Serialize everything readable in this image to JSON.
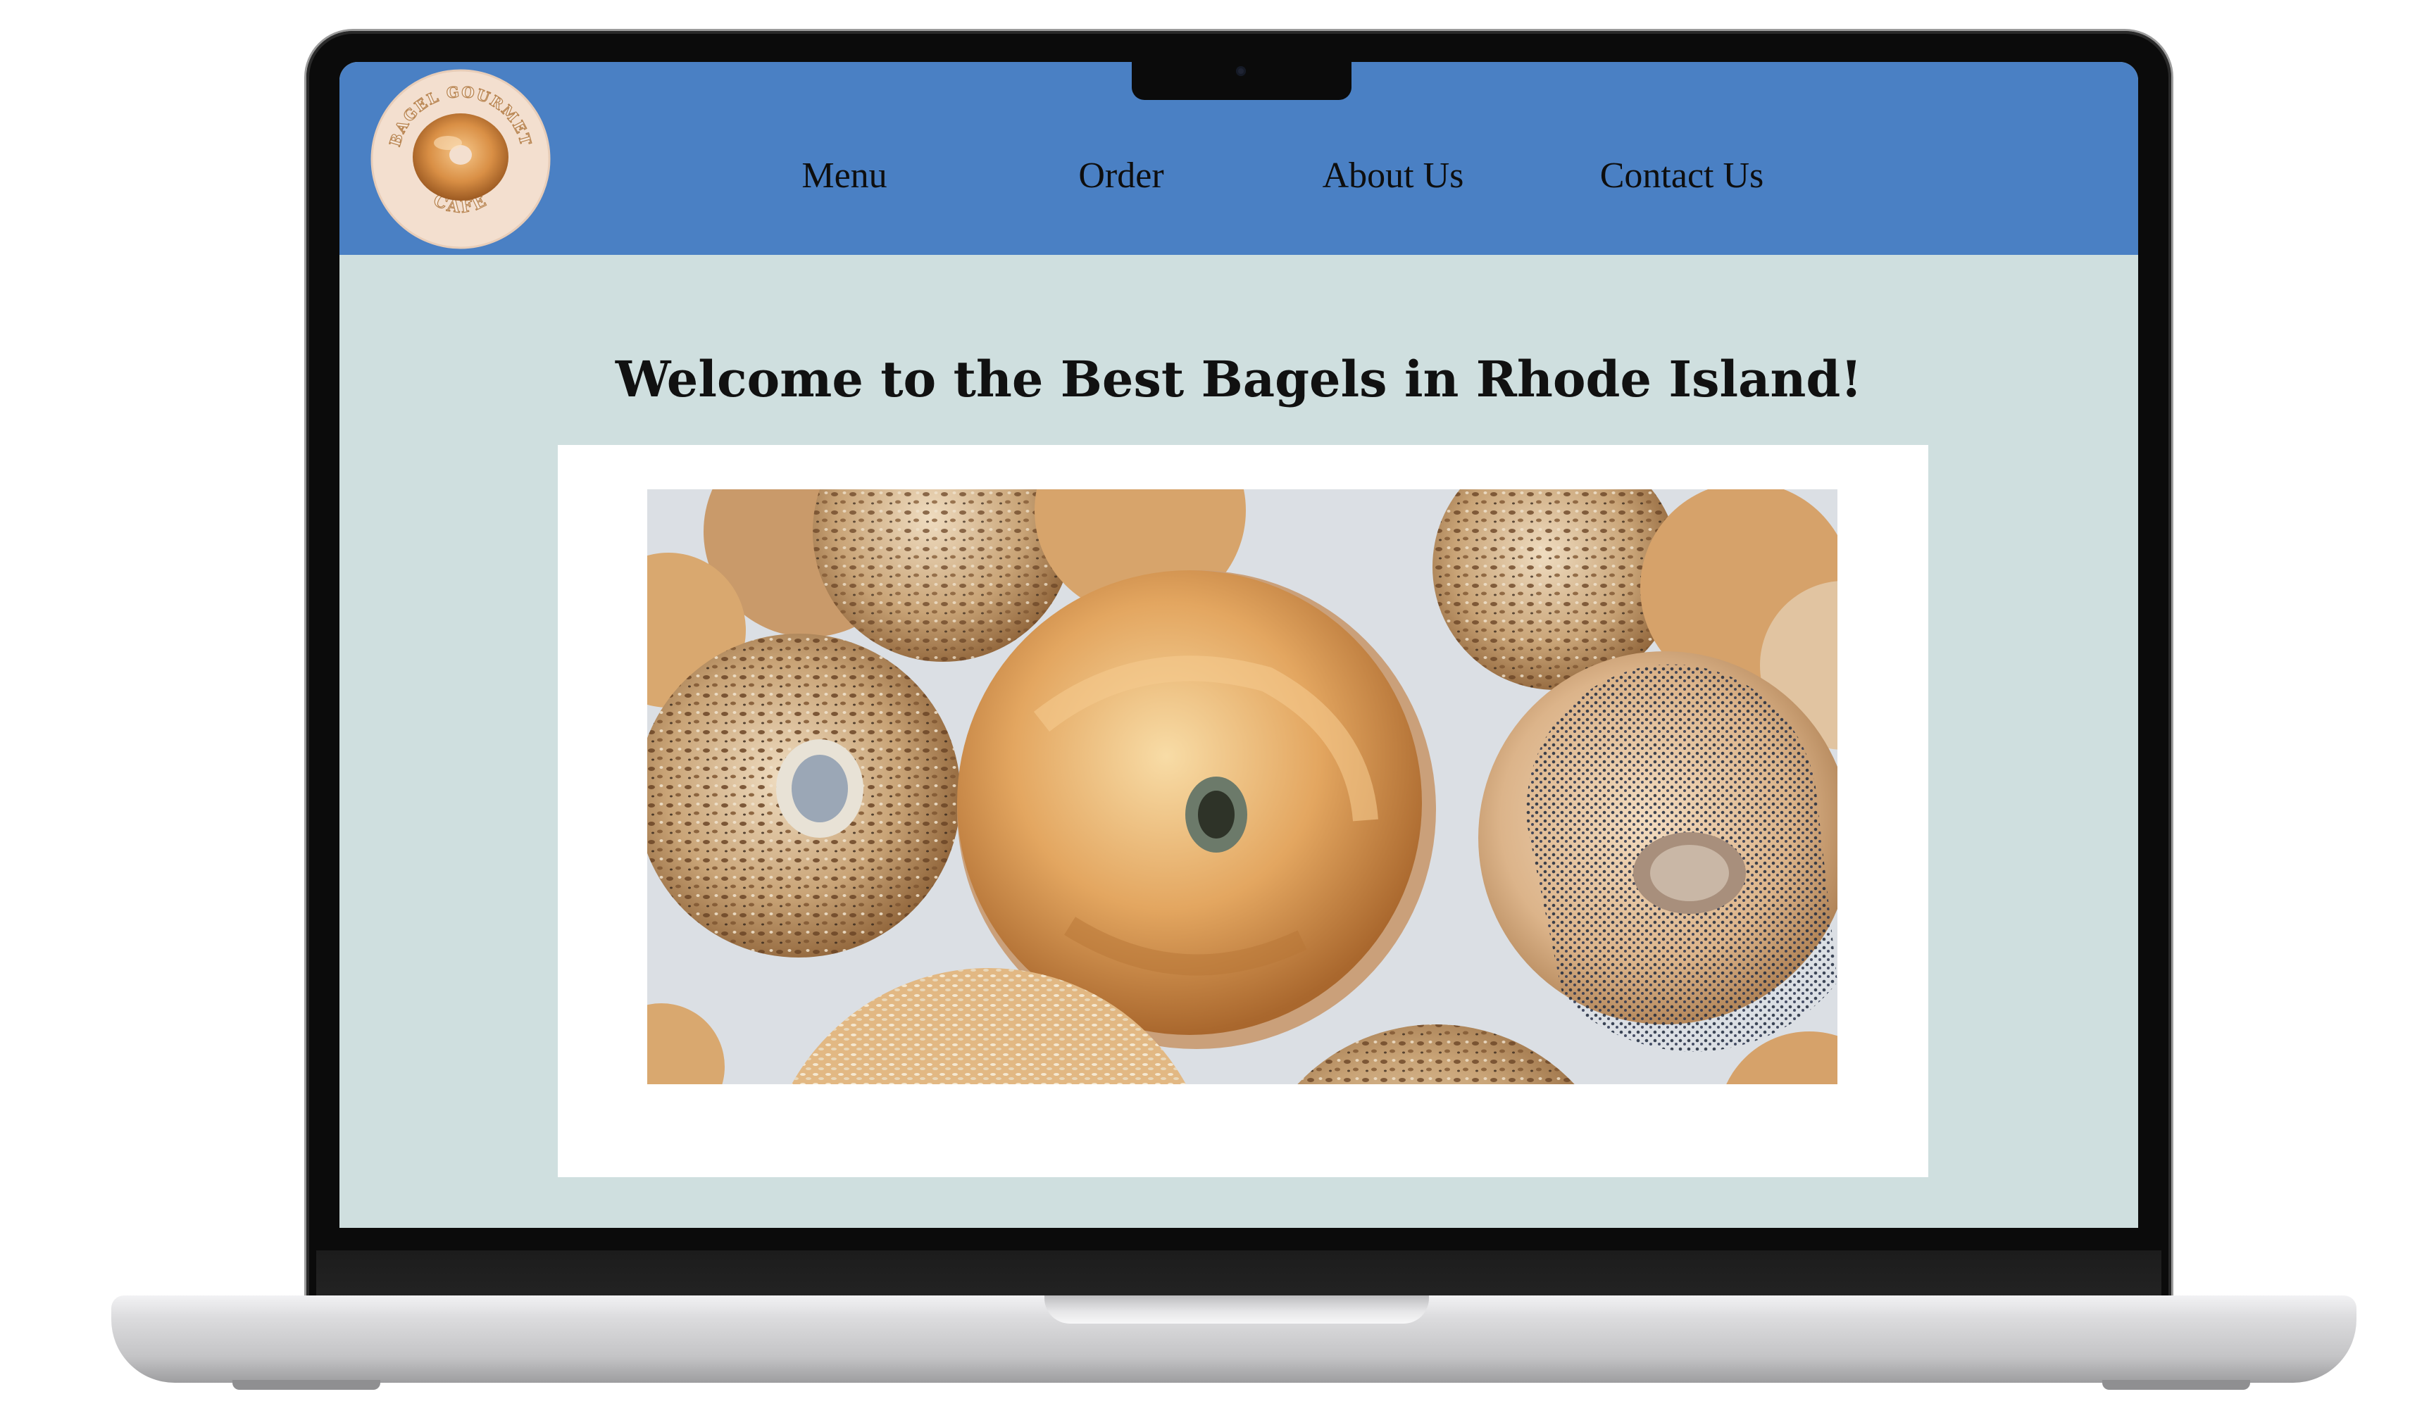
{
  "site": {
    "logo": {
      "top_text": "BAGEL GOURMET",
      "bottom_text": "CAFE",
      "icon": "bagel-logo-icon"
    },
    "nav": [
      {
        "label": "Menu"
      },
      {
        "label": "Order"
      },
      {
        "label": "About Us"
      },
      {
        "label": "Contact Us"
      }
    ]
  },
  "main": {
    "headline": "Welcome to the Best Bagels in Rhode Island!",
    "hero_image": {
      "alt": "assorted bagels: everything, plain, poppy seed and sesame"
    }
  },
  "colors": {
    "header": "#4a80c4",
    "page_background": "#cfdfdf",
    "image_frame": "#ffffff",
    "logo_badge": "#f3dfcf",
    "text": "#0e0e0e"
  }
}
